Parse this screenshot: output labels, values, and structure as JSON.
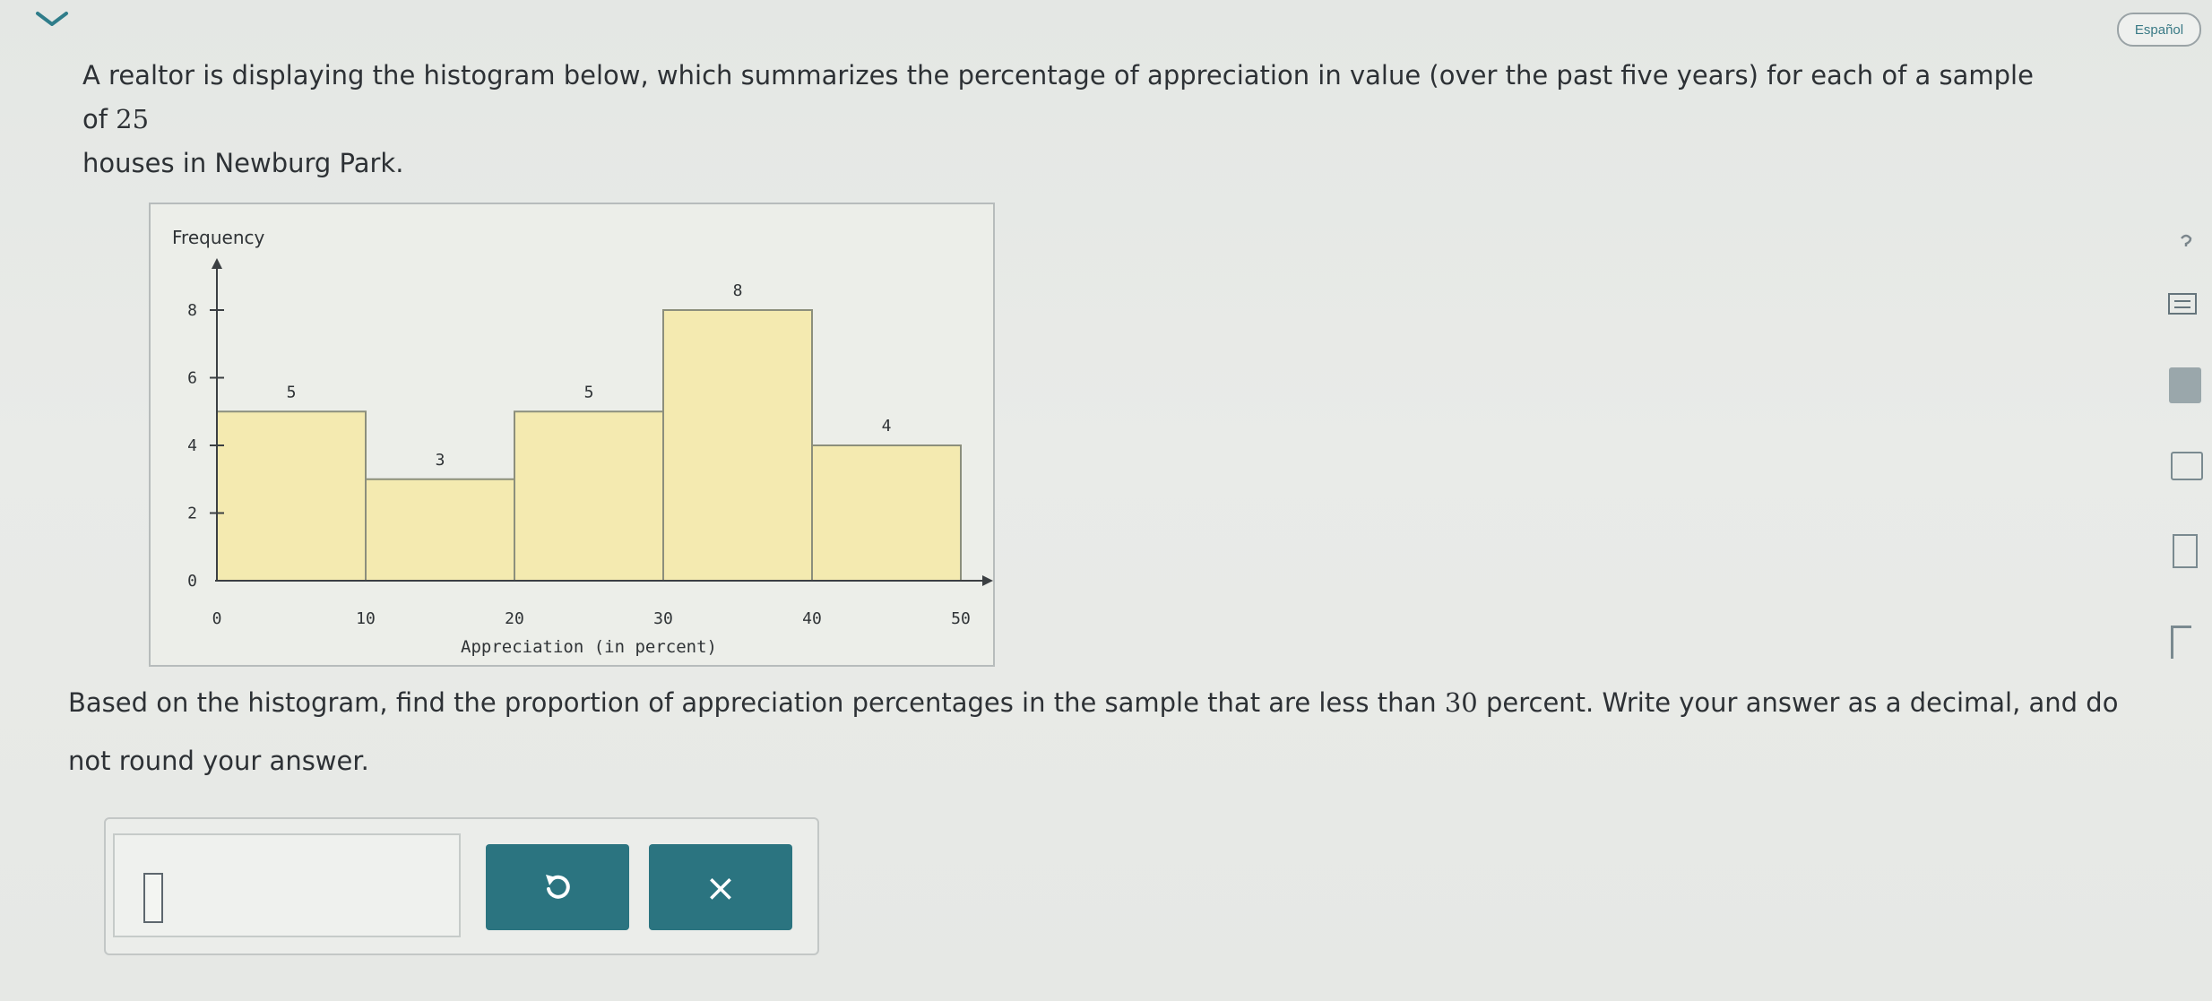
{
  "header": {
    "language_button": "Español"
  },
  "question": {
    "line1_before": "A realtor is displaying the histogram below, which summarizes the percentage of appreciation in value (over the past five years) for each of a sample of ",
    "sample_size": "25",
    "line2": "houses in Newburg Park."
  },
  "instruction": {
    "before": "Based on the histogram, find the proportion of appreciation percentages in the sample that are less than ",
    "threshold": "30",
    "after": " percent. Write your answer as a decimal, and do not round your answer."
  },
  "chart_data": {
    "type": "bar",
    "ylabel": "Frequency",
    "xlabel": "Appreciation (in percent)",
    "x_ticks": [
      "0",
      "10",
      "20",
      "30",
      "40",
      "50"
    ],
    "y_ticks": [
      "0",
      "2",
      "4",
      "6",
      "8"
    ],
    "xlim": [
      0,
      50
    ],
    "ylim": [
      0,
      8
    ],
    "bins": [
      {
        "from": 0,
        "to": 10,
        "value": 5,
        "label": "5"
      },
      {
        "from": 10,
        "to": 20,
        "value": 3,
        "label": "3"
      },
      {
        "from": 20,
        "to": 30,
        "value": 5,
        "label": "5"
      },
      {
        "from": 30,
        "to": 40,
        "value": 8,
        "label": "8"
      },
      {
        "from": 40,
        "to": 50,
        "value": 4,
        "label": "4"
      }
    ],
    "bar_color": "#f4eab0",
    "bar_stroke": "#8c8f7c"
  },
  "answer": {
    "value": "",
    "undo_icon": "undo-icon",
    "clear_label": "×",
    "button_color": "#2b7480"
  },
  "sidebar_tools": [
    "help-icon",
    "calculator-icon",
    "notes-icon",
    "video-icon",
    "book-icon",
    "reference-icon"
  ]
}
